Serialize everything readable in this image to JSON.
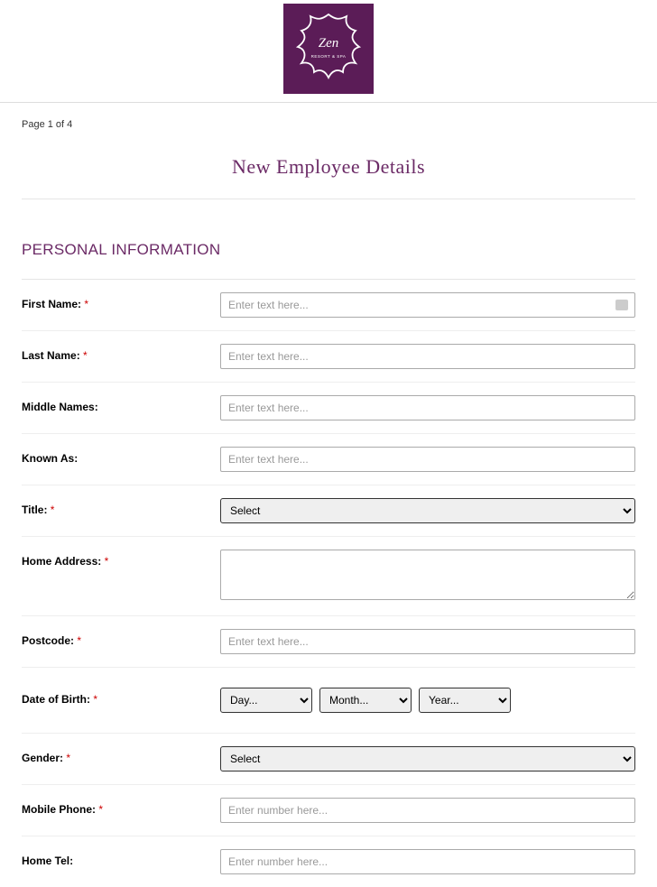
{
  "logo": {
    "brand_top": "Zen",
    "brand_sub": "RESORT & SPA"
  },
  "pageIndicator": "Page 1 of 4",
  "formTitle": "New Employee Details",
  "sectionTitle": "PERSONAL INFORMATION",
  "fields": {
    "firstName": {
      "label": "First Name:",
      "required": "*",
      "placeholder": "Enter text here..."
    },
    "lastName": {
      "label": "Last Name:",
      "required": "*",
      "placeholder": "Enter text here..."
    },
    "middleNames": {
      "label": "Middle Names:",
      "placeholder": "Enter text here..."
    },
    "knownAs": {
      "label": "Known As:",
      "placeholder": "Enter text here..."
    },
    "title": {
      "label": "Title:",
      "required": "*",
      "selected": "Select"
    },
    "homeAddress": {
      "label": "Home Address:",
      "required": "*"
    },
    "postcode": {
      "label": "Postcode:",
      "required": "*",
      "placeholder": "Enter text here..."
    },
    "dob": {
      "label": "Date of Birth:",
      "required": "*",
      "day": "Day...",
      "month": "Month...",
      "year": "Year..."
    },
    "gender": {
      "label": "Gender:",
      "required": "*",
      "selected": "Select"
    },
    "mobilePhone": {
      "label": "Mobile Phone:",
      "required": "*",
      "placeholder": "Enter number here..."
    },
    "homeTel": {
      "label": "Home Tel:",
      "placeholder": "Enter number here..."
    }
  }
}
